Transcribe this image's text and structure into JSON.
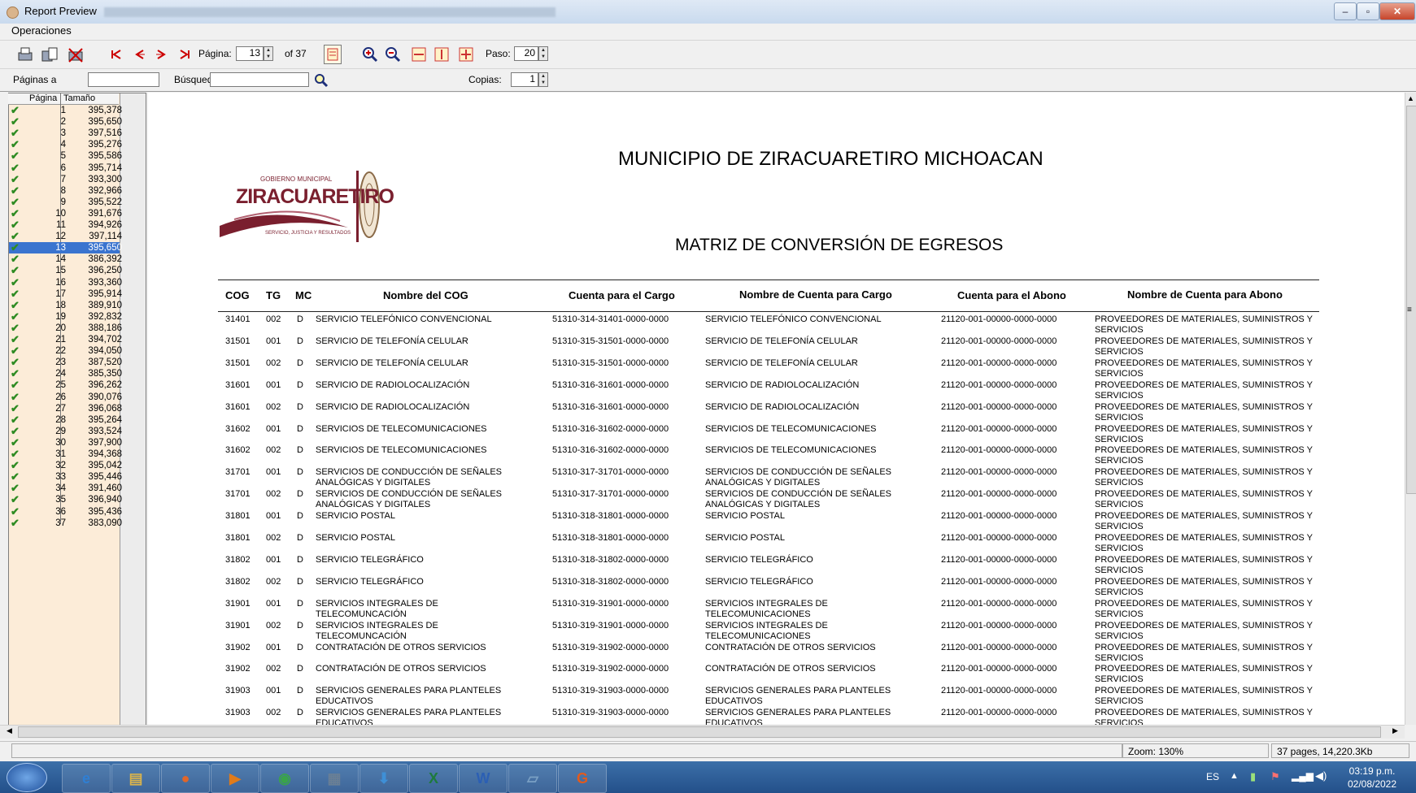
{
  "window": {
    "title": "Report Preview",
    "controls": {
      "minimize": "–",
      "restore": "▫",
      "close": "✕"
    }
  },
  "menu": {
    "operaciones": "Operaciones"
  },
  "toolbar": {
    "pagina_label": "Página:",
    "pagina_value": "13",
    "of_total": "of 37",
    "paso_label": "Paso:",
    "paso_value": "20"
  },
  "toolbar2": {
    "paginas_label": "Páginas a",
    "paginas_value": "",
    "busqueda_label": "Búsqued",
    "busqueda_value": "",
    "copias_label": "Copias:",
    "copias_value": "1"
  },
  "pages_panel": {
    "header_pagina": "Página",
    "header_tamano": "Tamaño",
    "selected_page": 13,
    "rows": [
      {
        "page": "1",
        "size": "395,378"
      },
      {
        "page": "2",
        "size": "395,650"
      },
      {
        "page": "3",
        "size": "397,516"
      },
      {
        "page": "4",
        "size": "395,276"
      },
      {
        "page": "5",
        "size": "395,586"
      },
      {
        "page": "6",
        "size": "395,714"
      },
      {
        "page": "7",
        "size": "393,300"
      },
      {
        "page": "8",
        "size": "392,966"
      },
      {
        "page": "9",
        "size": "395,522"
      },
      {
        "page": "10",
        "size": "391,676"
      },
      {
        "page": "11",
        "size": "394,926"
      },
      {
        "page": "12",
        "size": "397,114"
      },
      {
        "page": "13",
        "size": "395,650"
      },
      {
        "page": "14",
        "size": "386,392"
      },
      {
        "page": "15",
        "size": "396,250"
      },
      {
        "page": "16",
        "size": "393,360"
      },
      {
        "page": "17",
        "size": "395,914"
      },
      {
        "page": "18",
        "size": "389,910"
      },
      {
        "page": "19",
        "size": "392,832"
      },
      {
        "page": "20",
        "size": "388,186"
      },
      {
        "page": "21",
        "size": "394,702"
      },
      {
        "page": "22",
        "size": "394,050"
      },
      {
        "page": "23",
        "size": "387,520"
      },
      {
        "page": "24",
        "size": "385,350"
      },
      {
        "page": "25",
        "size": "396,262"
      },
      {
        "page": "26",
        "size": "390,076"
      },
      {
        "page": "27",
        "size": "396,068"
      },
      {
        "page": "28",
        "size": "395,264"
      },
      {
        "page": "29",
        "size": "393,524"
      },
      {
        "page": "30",
        "size": "397,900"
      },
      {
        "page": "31",
        "size": "394,368"
      },
      {
        "page": "32",
        "size": "395,042"
      },
      {
        "page": "33",
        "size": "395,446"
      },
      {
        "page": "34",
        "size": "391,460"
      },
      {
        "page": "35",
        "size": "396,940"
      },
      {
        "page": "36",
        "size": "395,436"
      },
      {
        "page": "37",
        "size": "383,090"
      }
    ]
  },
  "report": {
    "title": "MUNICIPIO DE ZIRACUARETIRO MICHOACAN",
    "subtitle": "MATRIZ DE CONVERSIÓN DE EGRESOS",
    "logo": {
      "top_text": "GOBIERNO MUNICIPAL",
      "name": "ZIRACUARETIRO",
      "tagline": "SERVICIO, JUSTICIA Y RESULTADOS"
    },
    "columns": {
      "cog": "COG",
      "tg": "TG",
      "mc": "MC",
      "nombre_cog": "Nombre del COG",
      "cuenta_cargo": "Cuenta para el Cargo",
      "nombre_cargo": "Nombre de Cuenta para Cargo",
      "cuenta_abono": "Cuenta para el Abono",
      "nombre_abono": "Nombre de Cuenta para Abono"
    },
    "rows": [
      {
        "cog": "31401",
        "tg": "002",
        "mc": "D",
        "nombre": "SERVICIO TELEFÓNICO CONVENCIONAL",
        "cargo": "51310-314-31401-0000-0000",
        "ncargo": "SERVICIO TELEFÓNICO CONVENCIONAL",
        "abono": "21120-001-00000-0000-0000",
        "nabono": "PROVEEDORES DE MATERIALES, SUMINISTROS Y SERVICIOS"
      },
      {
        "cog": "31501",
        "tg": "001",
        "mc": "D",
        "nombre": "SERVICIO DE TELEFONÍA CELULAR",
        "cargo": "51310-315-31501-0000-0000",
        "ncargo": "SERVICIO DE TELEFONÍA CELULAR",
        "abono": "21120-001-00000-0000-0000",
        "nabono": "PROVEEDORES DE MATERIALES, SUMINISTROS Y SERVICIOS"
      },
      {
        "cog": "31501",
        "tg": "002",
        "mc": "D",
        "nombre": "SERVICIO DE TELEFONÍA CELULAR",
        "cargo": "51310-315-31501-0000-0000",
        "ncargo": "SERVICIO DE TELEFONÍA CELULAR",
        "abono": "21120-001-00000-0000-0000",
        "nabono": "PROVEEDORES DE MATERIALES, SUMINISTROS Y SERVICIOS"
      },
      {
        "cog": "31601",
        "tg": "001",
        "mc": "D",
        "nombre": "SERVICIO DE RADIOLOCALIZACIÓN",
        "cargo": "51310-316-31601-0000-0000",
        "ncargo": "SERVICIO DE RADIOLOCALIZACIÓN",
        "abono": "21120-001-00000-0000-0000",
        "nabono": "PROVEEDORES DE MATERIALES, SUMINISTROS Y SERVICIOS"
      },
      {
        "cog": "31601",
        "tg": "002",
        "mc": "D",
        "nombre": "SERVICIO DE RADIOLOCALIZACIÓN",
        "cargo": "51310-316-31601-0000-0000",
        "ncargo": "SERVICIO DE RADIOLOCALIZACIÓN",
        "abono": "21120-001-00000-0000-0000",
        "nabono": "PROVEEDORES DE MATERIALES, SUMINISTROS Y SERVICIOS"
      },
      {
        "cog": "31602",
        "tg": "001",
        "mc": "D",
        "nombre": "SERVICIOS DE TELECOMUNICACIONES",
        "cargo": "51310-316-31602-0000-0000",
        "ncargo": "SERVICIOS DE TELECOMUNICACIONES",
        "abono": "21120-001-00000-0000-0000",
        "nabono": "PROVEEDORES DE MATERIALES, SUMINISTROS Y SERVICIOS"
      },
      {
        "cog": "31602",
        "tg": "002",
        "mc": "D",
        "nombre": "SERVICIOS DE TELECOMUNICACIONES",
        "cargo": "51310-316-31602-0000-0000",
        "ncargo": "SERVICIOS DE TELECOMUNICACIONES",
        "abono": "21120-001-00000-0000-0000",
        "nabono": "PROVEEDORES DE MATERIALES, SUMINISTROS Y SERVICIOS"
      },
      {
        "cog": "31701",
        "tg": "001",
        "mc": "D",
        "nombre": "SERVICIOS DE CONDUCCIÓN DE SEÑALES ANALÓGICAS Y DIGITALES",
        "cargo": "51310-317-31701-0000-0000",
        "ncargo": "SERVICIOS DE CONDUCCIÓN DE SEÑALES ANALÓGICAS Y DIGITALES",
        "abono": "21120-001-00000-0000-0000",
        "nabono": "PROVEEDORES DE MATERIALES, SUMINISTROS Y SERVICIOS"
      },
      {
        "cog": "31701",
        "tg": "002",
        "mc": "D",
        "nombre": "SERVICIOS DE CONDUCCIÓN DE SEÑALES ANALÓGICAS Y DIGITALES",
        "cargo": "51310-317-31701-0000-0000",
        "ncargo": "SERVICIOS DE CONDUCCIÓN DE SEÑALES ANALÓGICAS Y DIGITALES",
        "abono": "21120-001-00000-0000-0000",
        "nabono": "PROVEEDORES DE MATERIALES, SUMINISTROS Y SERVICIOS"
      },
      {
        "cog": "31801",
        "tg": "001",
        "mc": "D",
        "nombre": "SERVICIO POSTAL",
        "cargo": "51310-318-31801-0000-0000",
        "ncargo": "SERVICIO POSTAL",
        "abono": "21120-001-00000-0000-0000",
        "nabono": "PROVEEDORES DE MATERIALES, SUMINISTROS Y SERVICIOS"
      },
      {
        "cog": "31801",
        "tg": "002",
        "mc": "D",
        "nombre": "SERVICIO POSTAL",
        "cargo": "51310-318-31801-0000-0000",
        "ncargo": "SERVICIO POSTAL",
        "abono": "21120-001-00000-0000-0000",
        "nabono": "PROVEEDORES DE MATERIALES, SUMINISTROS Y SERVICIOS"
      },
      {
        "cog": "31802",
        "tg": "001",
        "mc": "D",
        "nombre": "SERVICIO TELEGRÁFICO",
        "cargo": "51310-318-31802-0000-0000",
        "ncargo": "SERVICIO TELEGRÁFICO",
        "abono": "21120-001-00000-0000-0000",
        "nabono": "PROVEEDORES DE MATERIALES, SUMINISTROS Y SERVICIOS"
      },
      {
        "cog": "31802",
        "tg": "002",
        "mc": "D",
        "nombre": "SERVICIO TELEGRÁFICO",
        "cargo": "51310-318-31802-0000-0000",
        "ncargo": "SERVICIO TELEGRÁFICO",
        "abono": "21120-001-00000-0000-0000",
        "nabono": "PROVEEDORES DE MATERIALES, SUMINISTROS Y SERVICIOS"
      },
      {
        "cog": "31901",
        "tg": "001",
        "mc": "D",
        "nombre": "SERVICIOS INTEGRALES DE TELECOMUNCACIÓN",
        "cargo": "51310-319-31901-0000-0000",
        "ncargo": "SERVICIOS INTEGRALES DE TELECOMUNICACIONES",
        "abono": "21120-001-00000-0000-0000",
        "nabono": "PROVEEDORES DE MATERIALES, SUMINISTROS Y SERVICIOS"
      },
      {
        "cog": "31901",
        "tg": "002",
        "mc": "D",
        "nombre": "SERVICIOS INTEGRALES DE TELECOMUNCACIÓN",
        "cargo": "51310-319-31901-0000-0000",
        "ncargo": "SERVICIOS INTEGRALES DE TELECOMUNICACIONES",
        "abono": "21120-001-00000-0000-0000",
        "nabono": "PROVEEDORES DE MATERIALES, SUMINISTROS Y SERVICIOS"
      },
      {
        "cog": "31902",
        "tg": "001",
        "mc": "D",
        "nombre": "CONTRATACIÓN DE OTROS SERVICIOS",
        "cargo": "51310-319-31902-0000-0000",
        "ncargo": "CONTRATACIÓN DE OTROS SERVICIOS",
        "abono": "21120-001-00000-0000-0000",
        "nabono": "PROVEEDORES DE MATERIALES, SUMINISTROS Y SERVICIOS"
      },
      {
        "cog": "31902",
        "tg": "002",
        "mc": "D",
        "nombre": "CONTRATACIÓN DE OTROS SERVICIOS",
        "cargo": "51310-319-31902-0000-0000",
        "ncargo": "CONTRATACIÓN DE OTROS SERVICIOS",
        "abono": "21120-001-00000-0000-0000",
        "nabono": "PROVEEDORES DE MATERIALES, SUMINISTROS Y SERVICIOS"
      },
      {
        "cog": "31903",
        "tg": "001",
        "mc": "D",
        "nombre": "SERVICIOS GENERALES PARA PLANTELES EDUCATIVOS",
        "cargo": "51310-319-31903-0000-0000",
        "ncargo": "SERVICIOS GENERALES PARA PLANTELES EDUCATIVOS",
        "abono": "21120-001-00000-0000-0000",
        "nabono": "PROVEEDORES DE MATERIALES, SUMINISTROS Y SERVICIOS"
      },
      {
        "cog": "31903",
        "tg": "002",
        "mc": "D",
        "nombre": "SERVICIOS GENERALES PARA PLANTELES EDUCATIVOS",
        "cargo": "51310-319-31903-0000-0000",
        "ncargo": "SERVICIOS GENERALES PARA PLANTELES EDUCATIVOS",
        "abono": "21120-001-00000-0000-0000",
        "nabono": "PROVEEDORES DE MATERIALES, SUMINISTROS Y SERVICIOS"
      }
    ]
  },
  "statusbar": {
    "zoom": "Zoom: 130%",
    "pages_info": "37 pages, 14,220.3Kb"
  },
  "taskbar": {
    "apps": [
      {
        "name": "internet-explorer",
        "glyph": "e"
      },
      {
        "name": "file-explorer",
        "glyph": "▤"
      },
      {
        "name": "firefox",
        "glyph": "●"
      },
      {
        "name": "media-player",
        "glyph": "▶"
      },
      {
        "name": "chrome",
        "glyph": "◉"
      },
      {
        "name": "calculator",
        "glyph": "▦"
      },
      {
        "name": "downloads",
        "glyph": "⬇"
      },
      {
        "name": "excel",
        "glyph": "X"
      },
      {
        "name": "word",
        "glyph": "W"
      },
      {
        "name": "notepad",
        "glyph": "▱"
      },
      {
        "name": "pdf-tool",
        "glyph": "G"
      }
    ],
    "lang": "ES",
    "time": "03:19 p.m.",
    "date": "02/08/2022"
  },
  "colors": {
    "selection": "#3a74cf",
    "check": "#2e8b22",
    "panel_bg": "#fcecd8",
    "taskbar": "#2b5b95",
    "logo_red": "#8b1a2e"
  }
}
